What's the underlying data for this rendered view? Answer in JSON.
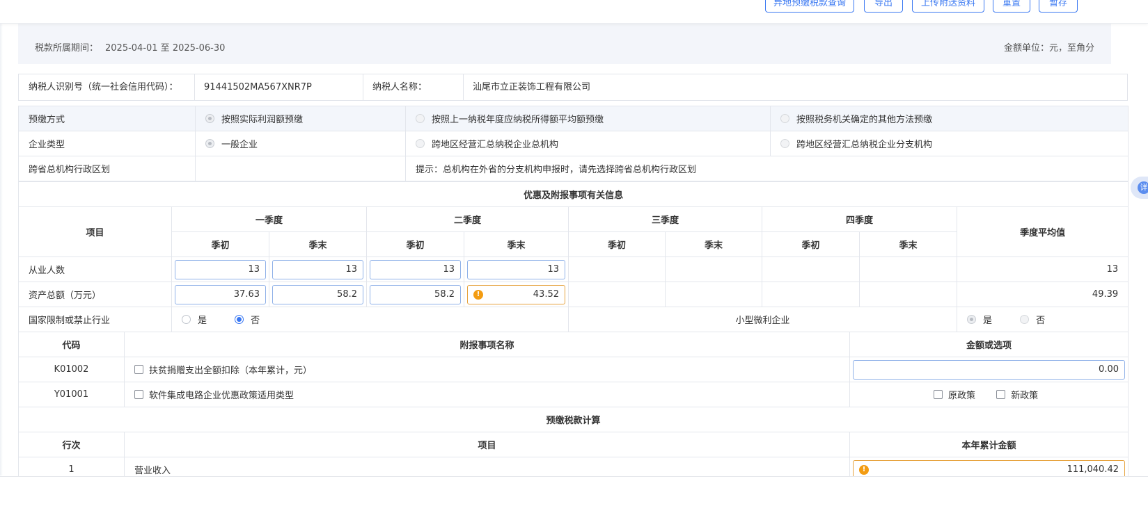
{
  "toolbar": {
    "buttons": [
      "异地预缴税款查询",
      "导出",
      "上传附送资料",
      "重置",
      "暂存"
    ]
  },
  "period": {
    "label": "税款所属期间：",
    "value": "2025-04-01 至 2025-06-30",
    "unit": "金额单位：元，至角分"
  },
  "taxpayer": {
    "id_label": "纳税人识别号（统一社会信用代码）：",
    "id_value": "91441502MA567XNR7P",
    "name_label": "纳税人名称：",
    "name_value": "汕尾市立正装饰工程有限公司"
  },
  "prepay_method": {
    "label": "预缴方式",
    "options": [
      "按照实际利润额预缴",
      "按照上一纳税年度应纳税所得额平均额预缴",
      "按照税务机关确定的其他方法预缴"
    ],
    "selected_index": 0
  },
  "enterprise_type": {
    "label": "企业类型",
    "options": [
      "一般企业",
      "跨地区经营汇总纳税企业总机构",
      "跨地区经营汇总纳税企业分支机构"
    ],
    "selected_index": 0
  },
  "cross_province": {
    "label": "跨省总机构行政区划",
    "value": "",
    "hint": "提示：总机构在外省的分支机构申报时，请先选择跨省总机构行政区划"
  },
  "preferential_section": {
    "title": "优惠及附报事项有关信息",
    "item_header": "项目",
    "quarters": [
      "一季度",
      "二季度",
      "三季度",
      "四季度"
    ],
    "sub_headers": [
      "季初",
      "季末"
    ],
    "avg_header": "季度平均值",
    "rows": [
      {
        "label": "从业人数",
        "values": [
          "13",
          "13",
          "13",
          "13",
          "",
          "",
          "",
          ""
        ],
        "average": "13"
      },
      {
        "label": "资产总额（万元）",
        "values": [
          "37.63",
          "58.2",
          "58.2",
          "43.52",
          "",
          "",
          "",
          ""
        ],
        "average": "49.39"
      }
    ],
    "restricted_industry": {
      "label": "国家限制或禁止行业",
      "yes": "是",
      "no": "否",
      "selected": "否"
    },
    "small_micro": {
      "label": "小型微利企业",
      "yes": "是",
      "no": "否",
      "selected": "是"
    }
  },
  "attachments": {
    "headers": {
      "code": "代码",
      "name": "附报事项名称",
      "amount": "金额或选项"
    },
    "rows": [
      {
        "code": "K01002",
        "name": "扶贫捐赠支出全额扣除（本年累计，元）",
        "amount": "0.00"
      },
      {
        "code": "Y01001",
        "name": "软件集成电路企业优惠政策适用类型",
        "options": [
          "原政策",
          "新政策"
        ]
      }
    ]
  },
  "calculation": {
    "title": "预缴税款计算",
    "headers": {
      "line": "行次",
      "item": "项目",
      "amount": "本年累计金额"
    },
    "rows": [
      {
        "line": "1",
        "item": "营业收入",
        "amount": "111,040.42"
      }
    ]
  },
  "side_tab": {
    "label": "详"
  },
  "colors": {
    "accent": "#3a78f2",
    "warning": "#f39c12",
    "header_bg": "#f3f5fa"
  }
}
